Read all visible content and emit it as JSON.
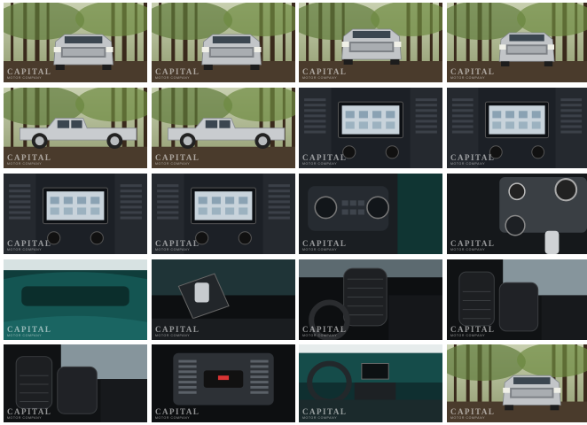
{
  "gallery": {
    "watermark_title": "CAPITAL",
    "watermark_sub": "MOTOR COMPANY",
    "tiles": [
      {
        "subject": "truck-front-three-quarter"
      },
      {
        "subject": "truck-front-three-quarter"
      },
      {
        "subject": "truck-front"
      },
      {
        "subject": "truck-rear-three-quarter"
      },
      {
        "subject": "truck-side-profile"
      },
      {
        "subject": "truck-side-profile"
      },
      {
        "subject": "infotainment-screen"
      },
      {
        "subject": "infotainment-screen"
      },
      {
        "subject": "infotainment-screen"
      },
      {
        "subject": "infotainment-screen"
      },
      {
        "subject": "climate-controls"
      },
      {
        "subject": "climate-knob-closeup"
      },
      {
        "subject": "dashboard-closeup"
      },
      {
        "subject": "center-console-shifter"
      },
      {
        "subject": "front-seats"
      },
      {
        "subject": "rear-seats"
      },
      {
        "subject": "rear-seats"
      },
      {
        "subject": "rear-vents"
      },
      {
        "subject": "dashboard-steering-wheel"
      },
      {
        "subject": "truck-front-three-quarter"
      }
    ]
  }
}
